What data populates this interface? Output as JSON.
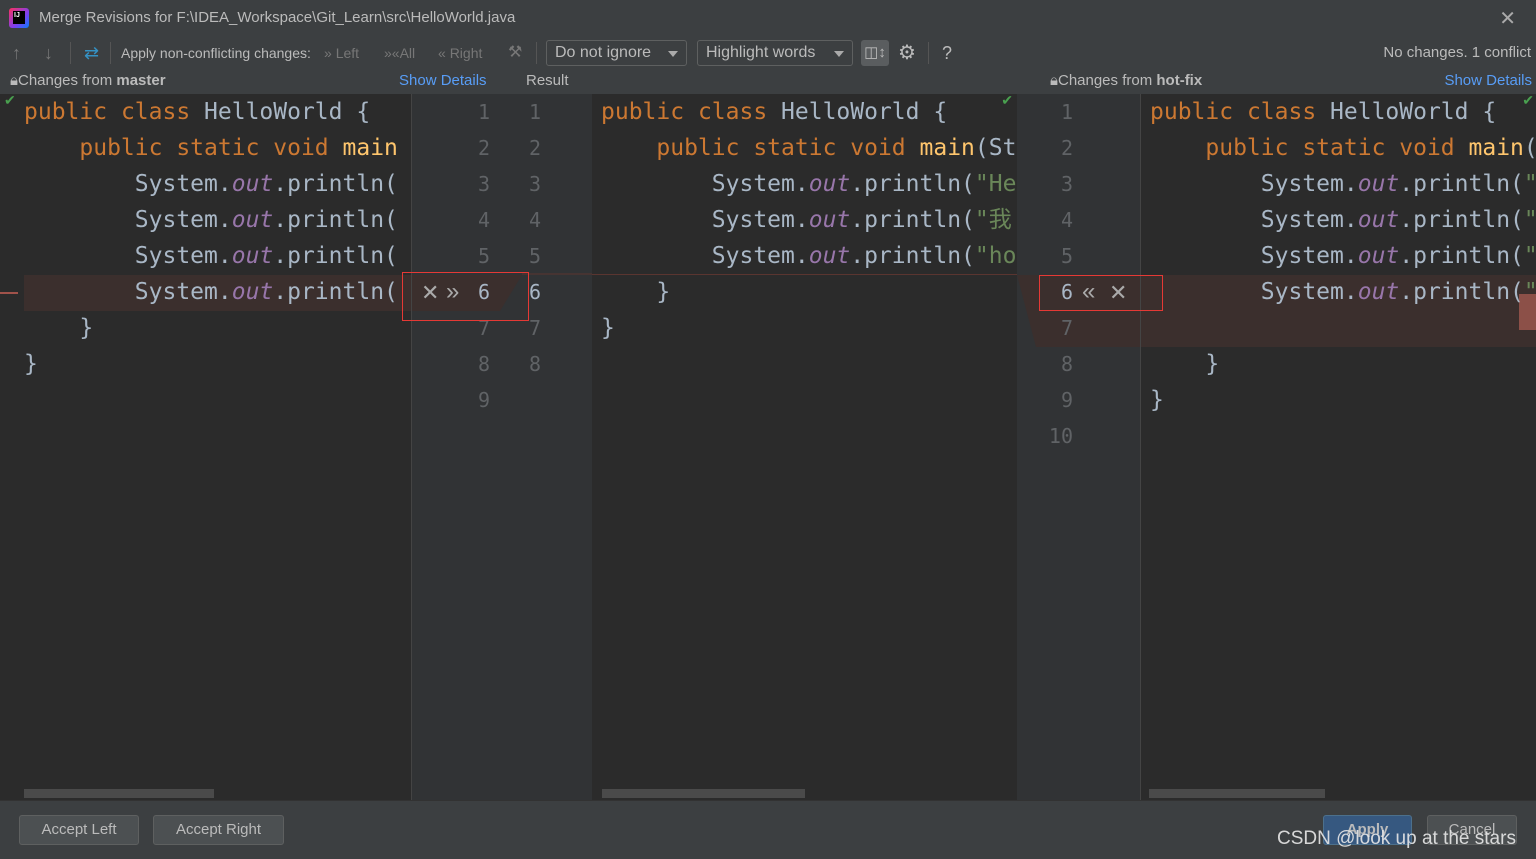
{
  "window": {
    "title": "Merge Revisions for F:\\IDEA_Workspace\\Git_Learn\\src\\HelloWorld.java",
    "app_icon_text": "IJ"
  },
  "toolbar": {
    "apply_label": "Apply non-conflicting changes:",
    "left": "Left",
    "all": "All",
    "right": "Right",
    "ignore_select": "Do not ignore",
    "highlight_select": "Highlight words",
    "status": "No changes. 1 conflict",
    "help": "?"
  },
  "headers": {
    "left_prefix": "Changes from ",
    "left_branch": "master",
    "show_details": "Show Details",
    "result": "Result",
    "right_prefix": "Changes from ",
    "right_branch": "hot-fix"
  },
  "editors": {
    "left": [
      [
        [
          "public ",
          "kw"
        ],
        [
          "class ",
          "kw"
        ],
        [
          "HelloWorld {",
          ""
        ]
      ],
      [
        [
          "    public ",
          "kw"
        ],
        [
          "static ",
          "kw"
        ],
        [
          "void ",
          "kw"
        ],
        [
          "main",
          "fn"
        ]
      ],
      [
        [
          "        System.",
          ""
        ],
        [
          "out",
          "fld"
        ],
        [
          ".println(",
          ""
        ]
      ],
      [
        [
          "        System.",
          ""
        ],
        [
          "out",
          "fld"
        ],
        [
          ".println(",
          ""
        ]
      ],
      [
        [
          "        System.",
          ""
        ],
        [
          "out",
          "fld"
        ],
        [
          ".println(",
          ""
        ]
      ],
      [
        [
          "        System.",
          ""
        ],
        [
          "out",
          "fld"
        ],
        [
          ".println(",
          ""
        ]
      ],
      [
        [
          "    }",
          ""
        ]
      ],
      [
        [
          "}",
          ""
        ]
      ]
    ],
    "result": [
      [
        [
          "public ",
          "kw"
        ],
        [
          "class ",
          "kw"
        ],
        [
          "HelloWorld {",
          ""
        ]
      ],
      [
        [
          "    public ",
          "kw"
        ],
        [
          "static ",
          "kw"
        ],
        [
          "void ",
          "kw"
        ],
        [
          "main",
          "fn"
        ],
        [
          "(St",
          ""
        ]
      ],
      [
        [
          "        System.",
          ""
        ],
        [
          "out",
          "fld"
        ],
        [
          ".println(",
          ""
        ],
        [
          "\"He",
          "str"
        ]
      ],
      [
        [
          "        System.",
          ""
        ],
        [
          "out",
          "fld"
        ],
        [
          ".println(",
          ""
        ],
        [
          "\"我",
          "str"
        ]
      ],
      [
        [
          "        System.",
          ""
        ],
        [
          "out",
          "fld"
        ],
        [
          ".println(",
          ""
        ],
        [
          "\"ho",
          "str"
        ]
      ],
      [
        [
          "    }",
          ""
        ]
      ],
      [
        [
          "}",
          ""
        ]
      ]
    ],
    "right": [
      [
        [
          "public ",
          "kw"
        ],
        [
          "class ",
          "kw"
        ],
        [
          "HelloWorld {",
          ""
        ]
      ],
      [
        [
          "    public ",
          "kw"
        ],
        [
          "static ",
          "kw"
        ],
        [
          "void ",
          "kw"
        ],
        [
          "main",
          "fn"
        ],
        [
          "(",
          ""
        ]
      ],
      [
        [
          "        System.",
          ""
        ],
        [
          "out",
          "fld"
        ],
        [
          ".println(",
          ""
        ],
        [
          "\"",
          "str"
        ]
      ],
      [
        [
          "        System.",
          ""
        ],
        [
          "out",
          "fld"
        ],
        [
          ".println(",
          ""
        ],
        [
          "\"",
          "str"
        ]
      ],
      [
        [
          "        System.",
          ""
        ],
        [
          "out",
          "fld"
        ],
        [
          ".println(",
          ""
        ],
        [
          "\"",
          "str"
        ]
      ],
      [
        [
          "        System.",
          ""
        ],
        [
          "out",
          "fld"
        ],
        [
          ".println(",
          ""
        ],
        [
          "\"",
          "str"
        ]
      ],
      [
        [
          "",
          ""
        ]
      ],
      [
        [
          "    }",
          ""
        ]
      ],
      [
        [
          "}",
          ""
        ]
      ]
    ]
  },
  "gutters": {
    "left_numbers": [
      "1",
      "2",
      "3",
      "4",
      "5",
      "6",
      "7",
      "8",
      "9"
    ],
    "result_numbers": [
      "1",
      "2",
      "3",
      "4",
      "5",
      "6",
      "7",
      "8"
    ],
    "right_numbers": [
      "1",
      "2",
      "3",
      "4",
      "5",
      "6",
      "7",
      "8",
      "9",
      "10"
    ]
  },
  "footer": {
    "accept_left": "Accept Left",
    "accept_right": "Accept Right",
    "apply": "Apply",
    "cancel": "Cancel",
    "watermark": "CSDN @look up at the stars"
  },
  "colors": {
    "accent": "#589df6",
    "conflict": "#3b2f2d",
    "keyword": "#cc7832",
    "apply_button": "#365880"
  }
}
